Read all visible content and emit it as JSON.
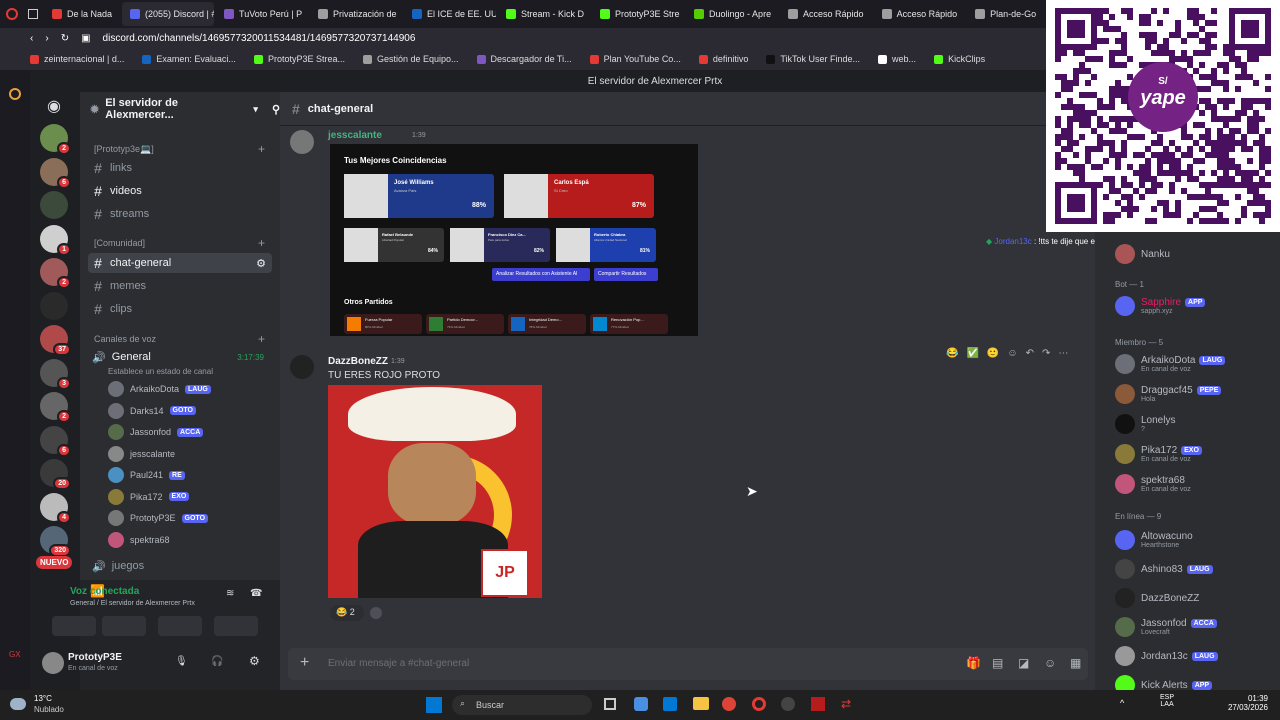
{
  "tabs": [
    {
      "label": "De la Nada",
      "color": "#e53935",
      "active": false
    },
    {
      "label": "(2055) Discord | #chat",
      "color": "#5865f2",
      "active": true
    },
    {
      "label": "TuVoto Perú | P",
      "color": "#7e57c2",
      "active": false
    },
    {
      "label": "Privatización de",
      "color": "#9e9e9e",
      "active": false
    },
    {
      "label": "El ICE de EE. UU.",
      "color": "#1565c0",
      "active": false
    },
    {
      "label": "Stream - Kick D",
      "color": "#53fc18",
      "active": false
    },
    {
      "label": "PrototyP3E Stre",
      "color": "#53fc18",
      "active": false
    },
    {
      "label": "Duolingo - Apre",
      "color": "#58cc02",
      "active": false
    },
    {
      "label": "Acceso Rápido",
      "color": "#9e9e9e",
      "active": false
    },
    {
      "label": "Acceso Rápido",
      "color": "#9e9e9e",
      "active": false
    },
    {
      "label": "Plan-de-Go",
      "color": "#9e9e9e",
      "active": false
    }
  ],
  "url": "discord.com/channels/1469577320011534481/1469577320737144906",
  "bookmarks": [
    {
      "label": "zeinternacional | d...",
      "color": "#e53935"
    },
    {
      "label": "Examen: Evaluaci...",
      "color": "#1565c0"
    },
    {
      "label": "PrototyP3E Strea...",
      "color": "#53fc18"
    },
    {
      "label": "Gestión de Equipo...",
      "color": "#9e9e9e"
    },
    {
      "label": "Descargador de Ti...",
      "color": "#7e57c2"
    },
    {
      "label": "Plan YouTube Co...",
      "color": "#e53935"
    },
    {
      "label": "definitivo",
      "color": "#e53935"
    },
    {
      "label": "TikTok User Finde...",
      "color": "#111111"
    },
    {
      "label": "web...",
      "color": "#ffffff"
    },
    {
      "label": "KickClips",
      "color": "#53fc18"
    }
  ],
  "window_title": "El servidor de Alexmercer Prtx",
  "server": {
    "name": "El servidor de Alexmercer..."
  },
  "server_list": [
    {
      "badge": "2",
      "color": "#6b8e4e"
    },
    {
      "badge": "6",
      "color": "#8a6e5a"
    },
    {
      "badge": "",
      "color": "#3b4a3a"
    },
    {
      "badge": "1",
      "color": "#cfcfcf"
    },
    {
      "badge": "2",
      "color": "#a05a5a"
    },
    {
      "badge": "",
      "color": "#2a2a2a"
    },
    {
      "badge": "37",
      "color": "#b04a4a"
    },
    {
      "badge": "3",
      "color": "#555555"
    },
    {
      "badge": "2",
      "color": "#666666"
    },
    {
      "badge": "6",
      "color": "#444444"
    },
    {
      "badge": "20",
      "color": "#3a3a3a"
    },
    {
      "badge": "4",
      "color": "#bbbbbb"
    },
    {
      "badge": "320",
      "color": "#556677"
    }
  ],
  "nuevo_label": "NUEVO",
  "categories": {
    "proto": "[Prototyp3e💻]",
    "comunidad": "[Comunidad]",
    "voz": "Canales de voz"
  },
  "text_channels": [
    "links",
    "videos",
    "streams",
    "chat-general",
    "memes",
    "clips"
  ],
  "voice_channel": {
    "name": "General",
    "time": "3:17:39",
    "status_hint": "Establece un estado de canal"
  },
  "voice_users": [
    {
      "name": "ArkaikoDota",
      "tag": "LAUG",
      "color": "#6d6f78"
    },
    {
      "name": "Darks14",
      "tag": "GOTO",
      "color": "#6d6f78"
    },
    {
      "name": "Jassonfod",
      "tag": "ACCA",
      "color": "#556b4a"
    },
    {
      "name": "jesscalante",
      "tag": "",
      "color": "#888888"
    },
    {
      "name": "Paul241",
      "tag": "RE",
      "color": "#4a90c2"
    },
    {
      "name": "Pika172",
      "tag": "EXO",
      "color": "#8a7a3a"
    },
    {
      "name": "PrototyP3E",
      "tag": "GOTO",
      "color": "#777777"
    },
    {
      "name": "spektra68",
      "tag": "",
      "color": "#c2557a"
    }
  ],
  "juegos_channel": "juegos",
  "voice_connected": {
    "title": "Voz conectada",
    "sub": "General / El servidor de Alexmercer Prtx"
  },
  "user_panel": {
    "name": "PrototyP3E",
    "status": "En canal de voz"
  },
  "channel_name": "chat-general",
  "messages": [
    {
      "author": "jesscalante",
      "time": "1:39",
      "author_color": "#43b581"
    },
    {
      "author": "DazzBoneZZ",
      "time": "1:39",
      "text": "TU ERES ROJO PROTO",
      "reaction_count": "2"
    }
  ],
  "embed": {
    "heading": "Tus Mejores Coincidencias",
    "top": [
      {
        "name": "José Williams",
        "party": "Avanza País",
        "pct": "88%",
        "color": "#1f3a8a"
      },
      {
        "name": "Carlos Espá",
        "party": "Sí Creo",
        "pct": "87%",
        "color": "#b71c1c"
      }
    ],
    "mid": [
      {
        "name": "Rafael Belaunde",
        "party": "Libertad Popular",
        "pct": "84%",
        "color": "#333333"
      },
      {
        "name": "Francisco Diez Ca...",
        "party": "País para todos",
        "pct": "82%",
        "color": "#2a2a5a"
      },
      {
        "name": "Roberto Chiabra",
        "party": "Alianza Unidad Nacional",
        "pct": "81%",
        "color": "#1e40af"
      }
    ],
    "buttons": [
      "Analizar Resultados con Asistente AI",
      "Compartir Resultados"
    ],
    "otros_heading": "Otros Partidos",
    "otros": [
      {
        "name": "Fuerza Popular",
        "pct": "80% Afinidad",
        "color": "#f57c00"
      },
      {
        "name": "Partido Democr...",
        "pct": "79% Afinidad",
        "color": "#2e7d32"
      },
      {
        "name": "Integridad Demo...",
        "pct": "78% Afinidad",
        "color": "#1565c0"
      },
      {
        "name": "Renovación Pop...",
        "pct": "77% Afinidad",
        "color": "#0288d1"
      }
    ]
  },
  "image_badge": "JP",
  "composer_placeholder": "Enviar mensaje a #chat-general",
  "pinned_msg": {
    "author": "Jordan13c",
    "text": "!tts te dije que era rojo ya canta la internacional"
  },
  "members_groups": {
    "bot": "Bot — 1",
    "miembro": "Miembro — 5",
    "enlinea": "En línea — 9"
  },
  "member_top": {
    "name": "Nanku"
  },
  "bots": [
    {
      "name": "Sapphire",
      "tag": "APP",
      "sub": "sapph.xyz",
      "color": "#5865f2"
    }
  ],
  "miembros": [
    {
      "name": "ArkaikoDota",
      "tag": "LAUG",
      "sub": "En canal de voz",
      "color": "#6d6f78"
    },
    {
      "name": "Draggacf45",
      "tag": "PEPE",
      "sub": "Hola",
      "color": "#8a5a3a"
    },
    {
      "name": "Lonelys",
      "tag": "",
      "sub": "?",
      "color": "#111111"
    },
    {
      "name": "Pika172",
      "tag": "EXO",
      "sub": "En canal de voz",
      "color": "#8a7a3a"
    },
    {
      "name": "spektra68",
      "tag": "",
      "sub": "En canal de voz",
      "color": "#c2557a"
    }
  ],
  "online": [
    {
      "name": "Altowacuno",
      "tag": "",
      "sub": "Hearthstone",
      "color": "#5865f2"
    },
    {
      "name": "Ashino83",
      "tag": "LAUG",
      "sub": "",
      "color": "#444444"
    },
    {
      "name": "DazzBoneZZ",
      "tag": "",
      "sub": "",
      "color": "#222222"
    },
    {
      "name": "Jassonfod",
      "tag": "ACCA",
      "sub": "Lovecraft",
      "color": "#556b4a"
    },
    {
      "name": "Jordan13c",
      "tag": "LAUG",
      "sub": "",
      "color": "#999999"
    },
    {
      "name": "Kick Alerts",
      "tag": "APP",
      "sub": "",
      "color": "#53fc18"
    }
  ],
  "taskbar": {
    "weather_temp": "13°C",
    "weather_text": "Nublado",
    "search": "Buscar",
    "lang1": "ESP",
    "lang2": "LAA",
    "time": "01:39",
    "date": "27/03/2026"
  },
  "qr": {
    "brand": "yape",
    "top": "S/"
  }
}
